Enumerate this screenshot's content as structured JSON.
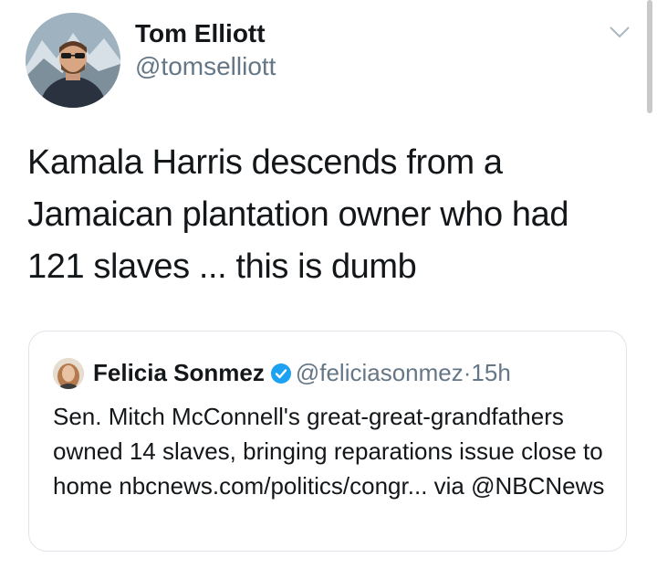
{
  "tweet": {
    "author_name": "Tom Elliott",
    "author_handle": "@tomselliott",
    "text": "Kamala Harris descends from a Jamaican plantation owner who had 121 slaves ... this is dumb"
  },
  "quoted_tweet": {
    "author_name": "Felicia Sonmez",
    "author_handle": "@feliciasonmez",
    "separator": "·",
    "time": "15h",
    "text": "Sen. Mitch McConnell's great-great-grandfathers owned 14 slaves, bringing reparations issue close to home nbcnews.com/politics/congr... via @NBCNews"
  },
  "icons": {
    "menu": "chevron-down-icon",
    "verified": "verified-badge-icon"
  },
  "colors": {
    "text": "#14171a",
    "secondary": "#657786",
    "verified": "#1da1f2",
    "card_border": "#dfe5ea"
  }
}
